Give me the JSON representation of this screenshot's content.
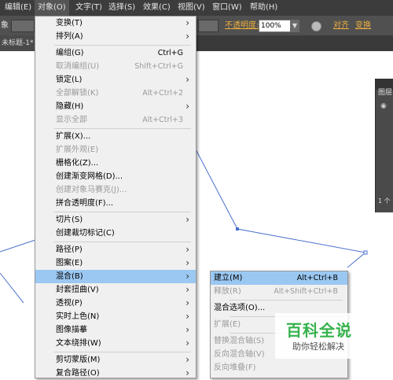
{
  "menubar": {
    "items": [
      "编辑(E)",
      "对象(O)",
      "文字(T)",
      "选择(S)",
      "效果(C)",
      "视图(V)",
      "窗口(W)",
      "帮助(H)"
    ]
  },
  "controlbar": {
    "left_text": "象",
    "opacity_label": "不透明度:",
    "opacity_value": "100%",
    "align_label": "对齐",
    "transform_label": "变换"
  },
  "tab": {
    "label": "未标题-1*"
  },
  "layers_panel": {
    "title": "图层",
    "footer": "1 个"
  },
  "object_menu": {
    "items": [
      {
        "label": "变换(T)",
        "submenu": true
      },
      {
        "label": "排列(A)",
        "submenu": true
      },
      {
        "label": "编组(G)",
        "shortcut": "Ctrl+G"
      },
      {
        "label": "取消编组(U)",
        "shortcut": "Shift+Ctrl+G",
        "disabled": true
      },
      {
        "label": "锁定(L)",
        "submenu": true
      },
      {
        "label": "全部解锁(K)",
        "shortcut": "Alt+Ctrl+2",
        "disabled": true
      },
      {
        "label": "隐藏(H)",
        "submenu": true
      },
      {
        "label": "显示全部",
        "shortcut": "Alt+Ctrl+3",
        "disabled": true
      },
      {
        "label": "扩展(X)..."
      },
      {
        "label": "扩展外观(E)",
        "disabled": true
      },
      {
        "label": "栅格化(Z)..."
      },
      {
        "label": "创建渐变网格(D)..."
      },
      {
        "label": "创建对象马赛克(J)...",
        "disabled": true
      },
      {
        "label": "拼合透明度(F)..."
      },
      {
        "label": "切片(S)",
        "submenu": true
      },
      {
        "label": "创建裁切标记(C)"
      },
      {
        "label": "路径(P)",
        "submenu": true
      },
      {
        "label": "图案(E)",
        "submenu": true
      },
      {
        "label": "混合(B)",
        "submenu": true,
        "highlighted": true
      },
      {
        "label": "封套扭曲(V)",
        "submenu": true
      },
      {
        "label": "透视(P)",
        "submenu": true
      },
      {
        "label": "实时上色(N)",
        "submenu": true
      },
      {
        "label": "图像描摹",
        "submenu": true
      },
      {
        "label": "文本绕排(W)",
        "submenu": true
      },
      {
        "label": "剪切蒙版(M)",
        "submenu": true
      },
      {
        "label": "复合路径(O)",
        "submenu": true
      }
    ]
  },
  "blend_submenu": {
    "items": [
      {
        "label": "建立(M)",
        "shortcut": "Alt+Ctrl+B",
        "highlighted": true
      },
      {
        "label": "释放(R)",
        "shortcut": "Alt+Shift+Ctrl+B",
        "disabled": true
      },
      {
        "label": "混合选项(O)..."
      },
      {
        "label": "扩展(E)",
        "disabled": true
      },
      {
        "label": "替换混合轴(S)",
        "disabled": true
      },
      {
        "label": "反向混合轴(V)",
        "disabled": true
      },
      {
        "label": "反向堆叠(F)",
        "disabled": true
      }
    ]
  },
  "watermark": {
    "title": "百科全说",
    "subtitle": "助你轻松解决"
  },
  "colors": {
    "menubar_bg": "#3c3c3c",
    "controlbar_bg": "#505050",
    "menu_bg": "#f0f0f0",
    "highlight": "#9bc8f2",
    "path_stroke": "#4a6fcf",
    "link": "#f0b040",
    "watermark_green": "#36b24c"
  }
}
